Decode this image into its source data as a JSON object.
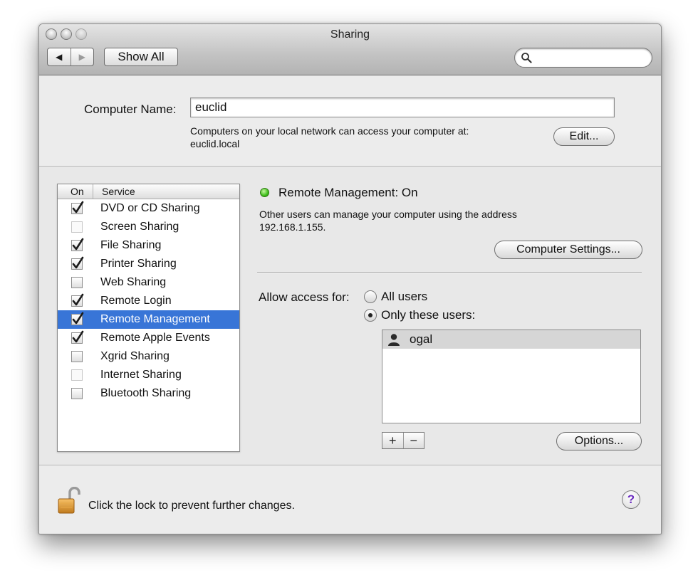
{
  "window": {
    "title": "Sharing"
  },
  "toolbar": {
    "back_glyph": "◀",
    "forward_glyph": "▶",
    "show_all_label": "Show All",
    "search": {
      "value": "",
      "placeholder": ""
    }
  },
  "computer_name": {
    "label": "Computer Name:",
    "value": "euclid",
    "description_line1": "Computers on your local network can access your computer at:",
    "description_line2": "euclid.local",
    "edit_label": "Edit..."
  },
  "services": {
    "header_on": "On",
    "header_service": "Service",
    "items": [
      {
        "name": "DVD or CD Sharing",
        "checked": true,
        "disabled": false,
        "selected": false
      },
      {
        "name": "Screen Sharing",
        "checked": false,
        "disabled": true,
        "selected": false
      },
      {
        "name": "File Sharing",
        "checked": true,
        "disabled": false,
        "selected": false
      },
      {
        "name": "Printer Sharing",
        "checked": true,
        "disabled": false,
        "selected": false
      },
      {
        "name": "Web Sharing",
        "checked": false,
        "disabled": false,
        "selected": false
      },
      {
        "name": "Remote Login",
        "checked": true,
        "disabled": false,
        "selected": false
      },
      {
        "name": "Remote Management",
        "checked": true,
        "disabled": false,
        "selected": true
      },
      {
        "name": "Remote Apple Events",
        "checked": true,
        "disabled": false,
        "selected": false
      },
      {
        "name": "Xgrid Sharing",
        "checked": false,
        "disabled": false,
        "selected": false
      },
      {
        "name": "Internet Sharing",
        "checked": false,
        "disabled": true,
        "selected": false
      },
      {
        "name": "Bluetooth Sharing",
        "checked": false,
        "disabled": false,
        "selected": false
      }
    ]
  },
  "detail": {
    "status": "Remote Management: On",
    "description_line1": "Other users can manage your computer using the address",
    "description_line2": "192.168.1.155.",
    "computer_settings_label": "Computer Settings...",
    "allow_access_label": "Allow access for:",
    "all_users_label": "All users",
    "only_these_label": "Only these users:",
    "selected_option": "only_these",
    "users": [
      "ogal"
    ],
    "add_label": "+",
    "remove_label": "−",
    "options_label": "Options..."
  },
  "footer": {
    "lock_text": "Click the lock to prevent further changes.",
    "help_label": "?"
  },
  "colors": {
    "selection": "#3875d7",
    "status_on": "#3fbf1b",
    "help": "#6a2bbf"
  }
}
